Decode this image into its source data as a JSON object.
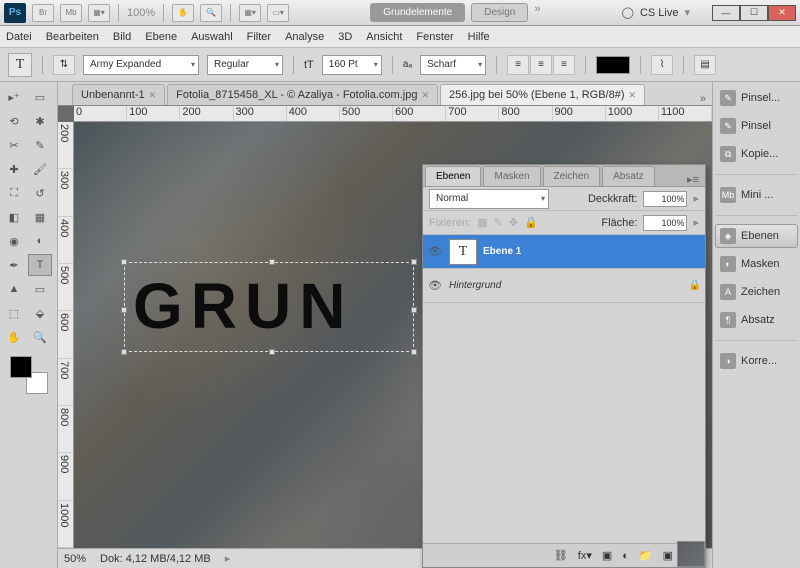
{
  "titlebar": {
    "zoom": "100%",
    "btn1": "Br",
    "btn2": "Mb",
    "pill_active": "Grundelemente",
    "pill": "Design",
    "cslive": "CS Live"
  },
  "menu": [
    "Datei",
    "Bearbeiten",
    "Bild",
    "Ebene",
    "Auswahl",
    "Filter",
    "Analyse",
    "3D",
    "Ansicht",
    "Fenster",
    "Hilfe"
  ],
  "options": {
    "tool": "T",
    "font": "Army Expanded",
    "weight": "Regular",
    "size": "160 Pt",
    "aa_label": "Scharf"
  },
  "tabs": [
    {
      "label": "Unbenannt-1",
      "active": false
    },
    {
      "label": "Fotolia_8715458_XL - © Azaliya - Fotolia.com.jpg",
      "active": false
    },
    {
      "label": "256.jpg bei 50% (Ebene 1, RGB/8#)",
      "active": true
    }
  ],
  "rulerH": [
    "0",
    "100",
    "200",
    "300",
    "400",
    "500",
    "600",
    "700",
    "800",
    "900",
    "1000",
    "1100"
  ],
  "rulerV": [
    "200",
    "300",
    "400",
    "500",
    "600",
    "700",
    "800",
    "900",
    "1000"
  ],
  "canvas_text": "GRUN",
  "status": {
    "zoom": "50%",
    "doc": "Dok: 4,12 MB/4,12 MB"
  },
  "dock": [
    {
      "label": "Pinsel...",
      "ico": "✎"
    },
    {
      "label": "Pinsel",
      "ico": "✎"
    },
    {
      "label": "Kopie...",
      "ico": "⧉"
    },
    {
      "sep": true
    },
    {
      "label": "Mini ...",
      "ico": "Mb"
    },
    {
      "sep": true
    },
    {
      "label": "Ebenen",
      "ico": "◈",
      "sel": true
    },
    {
      "label": "Masken",
      "ico": "◐"
    },
    {
      "label": "Zeichen",
      "ico": "A"
    },
    {
      "label": "Absatz",
      "ico": "¶"
    },
    {
      "sep": true
    },
    {
      "label": "Korre...",
      "ico": "◑"
    }
  ],
  "panel": {
    "tabs": [
      "Ebenen",
      "Masken",
      "Zeichen",
      "Absatz"
    ],
    "blend": "Normal",
    "opacity_label": "Deckkraft:",
    "opacity": "100%",
    "lock_label": "Fixieren:",
    "fill_label": "Fläche:",
    "fill": "100%",
    "layers": [
      {
        "name": "Ebene 1",
        "type": "T",
        "sel": true,
        "locked": false
      },
      {
        "name": "Hintergrund",
        "type": "bg",
        "sel": false,
        "locked": true
      }
    ]
  }
}
